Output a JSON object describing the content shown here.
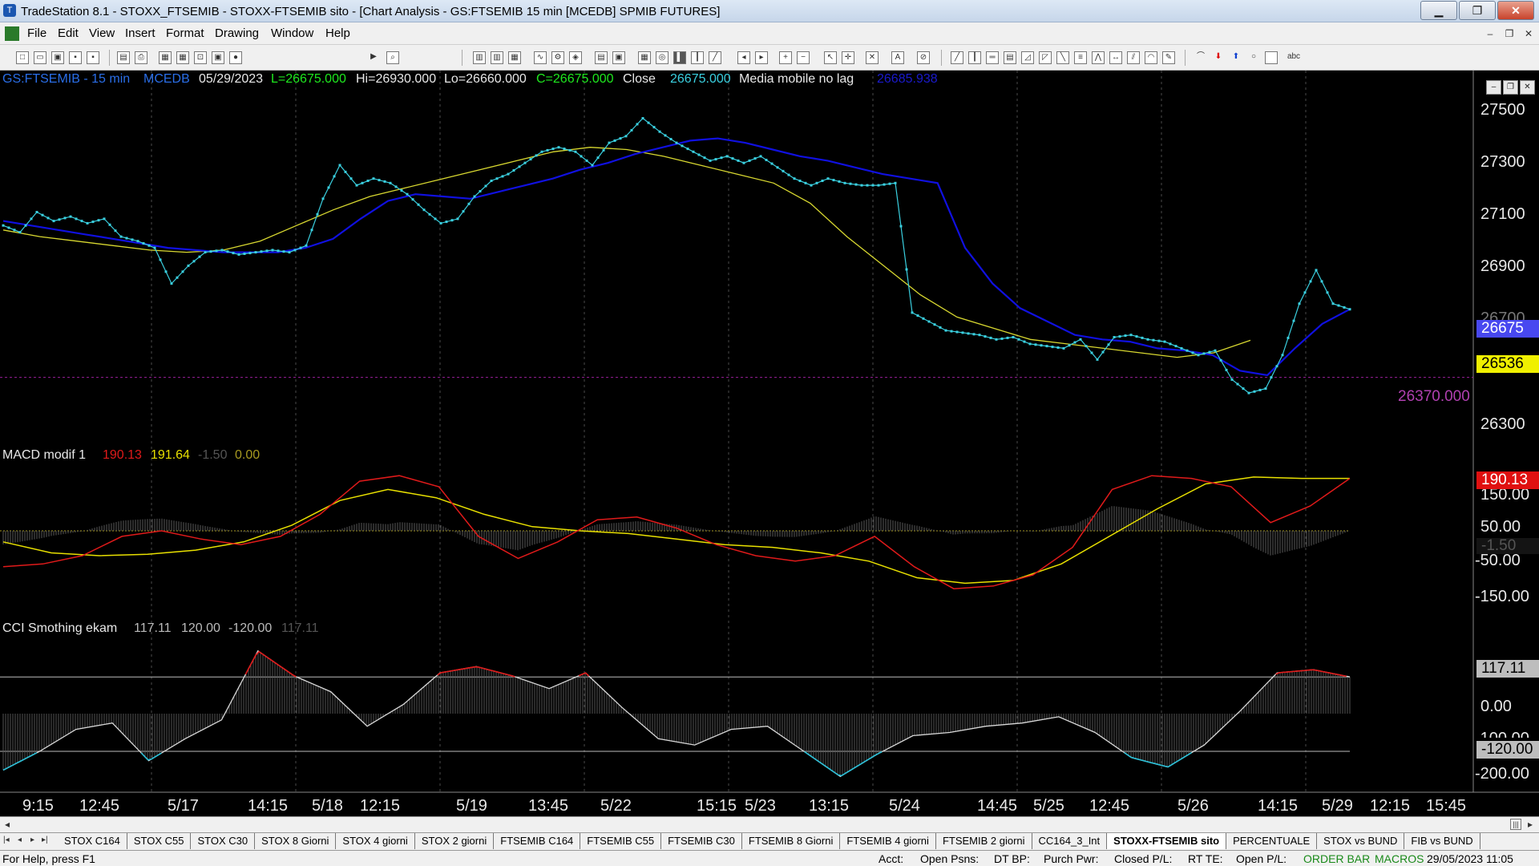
{
  "window": {
    "title": "TradeStation 8.1 - STOXX_FTSEMIB - STOXX-FTSEMIB sito - [Chart Analysis - GS:FTSEMIB  15 min  [MCEDB] SPMIB FUTURES]",
    "min": "▁",
    "max": "❐",
    "close": "✕"
  },
  "menu": [
    "File",
    "Edit",
    "View",
    "Insert",
    "Format",
    "Drawing",
    "Window",
    "Help"
  ],
  "mdi_controls": [
    "–",
    "❐",
    "✕"
  ],
  "toolbar": {
    "symbol": "R"
  },
  "chart_header": {
    "symbol": "GS:FTSEMIB - 15 min",
    "exchange": "MCEDB",
    "date": "05/29/2023",
    "last": "L=26675.000",
    "high": "Hi=26930.000",
    "low": "Lo=26660.000",
    "close": "C=26675.000",
    "close_label": "Close",
    "close_value": "26675.000",
    "ma_label": "Media mobile no lag",
    "ma_value": "26685.938"
  },
  "macd_header": {
    "name": "MACD modif 1",
    "v1": "190.13",
    "v2": "191.64",
    "v3": "-1.50",
    "v4": "0.00"
  },
  "cci_header": {
    "name": "CCI Smothing ekam",
    "v1": "117.11",
    "v2": "120.00",
    "v3": "-120.00",
    "v4": "117.11"
  },
  "price_axis": [
    "27500",
    "27300",
    "27100",
    "26900",
    "26700",
    "26300"
  ],
  "macd_axis": [
    "150.00",
    "50.00",
    "-50.00",
    "-150.00"
  ],
  "cci_axis": [
    "0.00",
    "-100.00",
    "-200.00"
  ],
  "price_boxes": {
    "last": "26675",
    "ma": "26536",
    "hline": "26370.000",
    "macd": "190.13",
    "macd_zero": "-1.50",
    "cci": "117.11",
    "cci_low": "-120.00"
  },
  "x_labels": [
    {
      "t": "9:15",
      "x": 48
    },
    {
      "t": "12:45",
      "x": 119
    },
    {
      "t": "5/17",
      "x": 229
    },
    {
      "t": "14:15",
      "x": 329
    },
    {
      "t": "5/18",
      "x": 409
    },
    {
      "t": "12:15",
      "x": 469
    },
    {
      "t": "5/19",
      "x": 589
    },
    {
      "t": "13:45",
      "x": 679
    },
    {
      "t": "5/22",
      "x": 769
    },
    {
      "t": "15:15",
      "x": 889
    },
    {
      "t": "5/23",
      "x": 949
    },
    {
      "t": "13:15",
      "x": 1029
    },
    {
      "t": "5/24",
      "x": 1129
    },
    {
      "t": "14:45",
      "x": 1239
    },
    {
      "t": "5/25",
      "x": 1309
    },
    {
      "t": "12:45",
      "x": 1379
    },
    {
      "t": "5/26",
      "x": 1489
    },
    {
      "t": "14:15",
      "x": 1589
    },
    {
      "t": "5/29",
      "x": 1669
    },
    {
      "t": "12:15",
      "x": 1729
    },
    {
      "t": "15:45",
      "x": 1799
    }
  ],
  "tabs": [
    "STOX C164",
    "STOX C55",
    "STOX  C30",
    "STOX  8 Giorni",
    "STOX 4 giorni",
    "STOX  2 giorni",
    "FTSEMIB C164",
    "FTSEMIB C55",
    "FTSEMIB C30",
    "FTSEMIB  8 Giorni",
    "FTSEMIB  4 giorni",
    "FTSEMIB  2 giorni",
    "CC164_3_Int",
    "STOXX-FTSEMIB sito",
    "PERCENTUALE",
    "STOX vs BUND",
    "FIB vs BUND"
  ],
  "active_tab": "STOXX-FTSEMIB sito",
  "status": {
    "help": "For Help, press F1",
    "acct": "Acct:",
    "open_psns": "Open Psns:",
    "dt_bp": "DT BP:",
    "purch_pwr": "Purch Pwr:",
    "closed_pl": "Closed P/L:",
    "rt_te": "RT TE:",
    "open_pl": "Open P/L:",
    "order_bar": "ORDER BAR",
    "macros": "MACROS",
    "datetime": "29/05/2023 11:05"
  },
  "colors": {
    "price": "#3ad0e0",
    "ma_blue": "#1010e0",
    "ma_yellow": "#d8d830",
    "macd_red": "#e01a1a",
    "macd_yellow": "#e8e000",
    "cci_white": "#d8d8d8",
    "hline": "#9a1e9a",
    "green_text": "#1ee81e"
  },
  "chart_data": [
    {
      "type": "line",
      "title": "GS:FTSEMIB - 15 min",
      "ylim": [
        26200,
        27600
      ],
      "series": [
        {
          "name": "Close",
          "values": [
            27050,
            27020,
            27110,
            27070,
            27090,
            27060,
            27080,
            27000,
            26980,
            26950,
            26790,
            26870,
            26930,
            26940,
            26920,
            26930,
            26940,
            26930,
            26960,
            27170,
            27320,
            27230,
            27260,
            27240,
            27190,
            27120,
            27060,
            27080,
            27180,
            27250,
            27280,
            27330,
            27380,
            27400,
            27380,
            27320,
            27420,
            27450,
            27530,
            27470,
            27420,
            27380,
            27340,
            27360,
            27330,
            27360,
            27310,
            27260,
            27230,
            27260,
            27240,
            27230,
            27230,
            27240,
            26660,
            26620,
            26580,
            26570,
            26560,
            26540,
            26550,
            26520,
            26510,
            26500,
            26540,
            26450,
            26550,
            26560,
            26540,
            26530,
            26500,
            26470,
            26490,
            26360,
            26300,
            26320,
            26470,
            26700,
            26850,
            26700,
            26675
          ]
        },
        {
          "name": "Media mobile no lag",
          "values": [
            27070,
            27050,
            27030,
            27010,
            26990,
            26970,
            26950,
            26940,
            26930,
            26930,
            26930,
            26950,
            26990,
            27080,
            27160,
            27190,
            27180,
            27170,
            27200,
            27230,
            27260,
            27300,
            27330,
            27370,
            27400,
            27430,
            27440,
            27420,
            27390,
            27360,
            27340,
            27310,
            27280,
            27260,
            27240,
            26950,
            26790,
            26680,
            26620,
            26560,
            26540,
            26530,
            26500,
            26490,
            26470,
            26400,
            26380,
            26500,
            26610,
            26675
          ]
        },
        {
          "name": "MA yellow",
          "values": [
            27030,
            27000,
            26980,
            26960,
            26940,
            26930,
            26940,
            26980,
            27050,
            27120,
            27180,
            27220,
            27260,
            27300,
            27340,
            27380,
            27400,
            27390,
            27360,
            27320,
            27280,
            27240,
            27150,
            27000,
            26870,
            26740,
            26640,
            26590,
            26540,
            26520,
            26500,
            26480,
            26460,
            26480,
            26536
          ]
        }
      ]
    },
    {
      "type": "line",
      "title": "MACD modif 1",
      "ylim": [
        -250,
        250
      ],
      "series": [
        {
          "name": "MACD",
          "values": [
            -130,
            -120,
            -90,
            -20,
            0,
            -30,
            -50,
            -20,
            60,
            180,
            200,
            160,
            -20,
            -100,
            -40,
            40,
            50,
            10,
            -50,
            -90,
            -110,
            -90,
            -20,
            -130,
            -210,
            -200,
            -160,
            -60,
            150,
            200,
            190,
            160,
            30,
            90,
            190
          ]
        },
        {
          "name": "Signal",
          "values": [
            -40,
            -80,
            -90,
            -85,
            -70,
            -40,
            20,
            110,
            150,
            120,
            60,
            15,
            0,
            -10,
            -30,
            -50,
            -60,
            -80,
            -110,
            -170,
            -190,
            -180,
            -120,
            -20,
            80,
            170,
            195,
            190,
            190
          ]
        }
      ]
    },
    {
      "type": "line",
      "title": "CCI Smothing ekam",
      "ylim": [
        -230,
        230
      ],
      "series": [
        {
          "name": "CCI",
          "values": [
            -180,
            -120,
            -50,
            -30,
            -150,
            -80,
            -20,
            200,
            120,
            70,
            -40,
            30,
            130,
            150,
            120,
            80,
            130,
            20,
            -80,
            -100,
            -50,
            -40,
            -120,
            -200,
            -130,
            -70,
            -60,
            -40,
            -30,
            -10,
            -60,
            -140,
            -170,
            -100,
            10,
            130,
            140,
            117
          ]
        }
      ]
    }
  ]
}
